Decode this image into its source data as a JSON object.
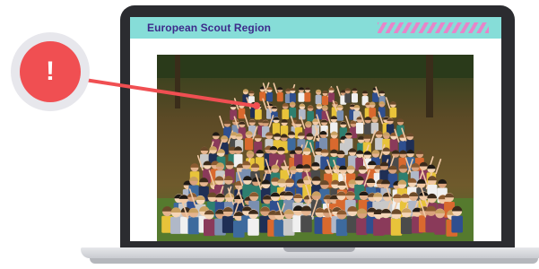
{
  "screen": {
    "site_title": "European Scout Region",
    "photo_alt": "European Scout Region group photo"
  },
  "alert": {
    "icon": "exclamation-icon",
    "glyph": "!",
    "color": "#f04f52"
  },
  "colors": {
    "header_bg": "#86ddd8",
    "title_text": "#3d2a8a",
    "stripe_accent": "#e884c9",
    "laptop_bezel": "#2b2c30"
  }
}
